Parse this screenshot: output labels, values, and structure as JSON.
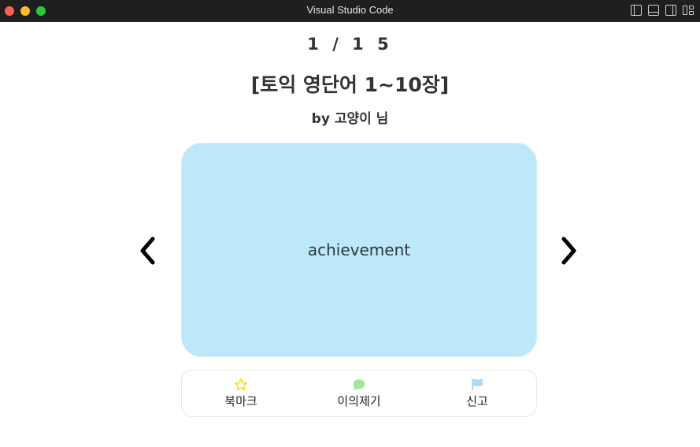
{
  "window": {
    "title": "Visual Studio Code"
  },
  "viewer": {
    "counter": "1 / 1 5",
    "deck_title": "[토익 영단어 1~10장]",
    "author": "by 고양이 님"
  },
  "card": {
    "word": "achievement",
    "background_color": "#bde8f9"
  },
  "navigation": {
    "prev_icon": "chevron-left-icon",
    "next_icon": "chevron-right-icon"
  },
  "actions": [
    {
      "label": "북마크",
      "icon": "star-icon",
      "color": "#f5e31a"
    },
    {
      "label": "이의제기",
      "icon": "speech-bubble-icon",
      "color": "#9ee89a"
    },
    {
      "label": "신고",
      "icon": "flag-icon",
      "color": "#a9dbf5"
    }
  ]
}
